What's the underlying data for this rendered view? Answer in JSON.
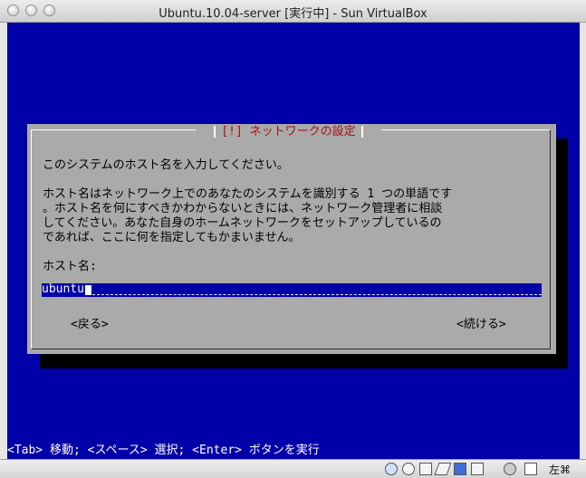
{
  "window": {
    "title": "Ubuntu.10.04-server [実行中] - Sun VirtualBox"
  },
  "dialog": {
    "title": "[!] ネットワークの設定",
    "prompt": "このシステムのホスト名を入力してください。",
    "description_lines": [
      "ホスト名はネットワーク上でのあなたのシステムを識別する 1 つの単語です",
      "。ホスト名を何にすべきかわからないときには、ネットワーク管理者に相談",
      "してください。あなた自身のホームネットワークをセットアップしているの",
      "であれば、ここに何を指定してもかまいません。"
    ],
    "field_label": "ホスト名:",
    "hostname_value": "ubuntu",
    "back_button": "<戻る>",
    "continue_button": "<続ける>"
  },
  "status_bar": {
    "help_text": "<Tab> 移動; <スペース> 選択; <Enter> ボタンを実行"
  },
  "vbox_status": {
    "host_key_label": "左⌘",
    "icons": [
      "hdd-icon",
      "cd-icon",
      "network-icon",
      "usb-icon",
      "shared-folder-icon",
      "cpu-icon",
      "mouse-icon",
      "keyboard-capture-icon"
    ]
  }
}
